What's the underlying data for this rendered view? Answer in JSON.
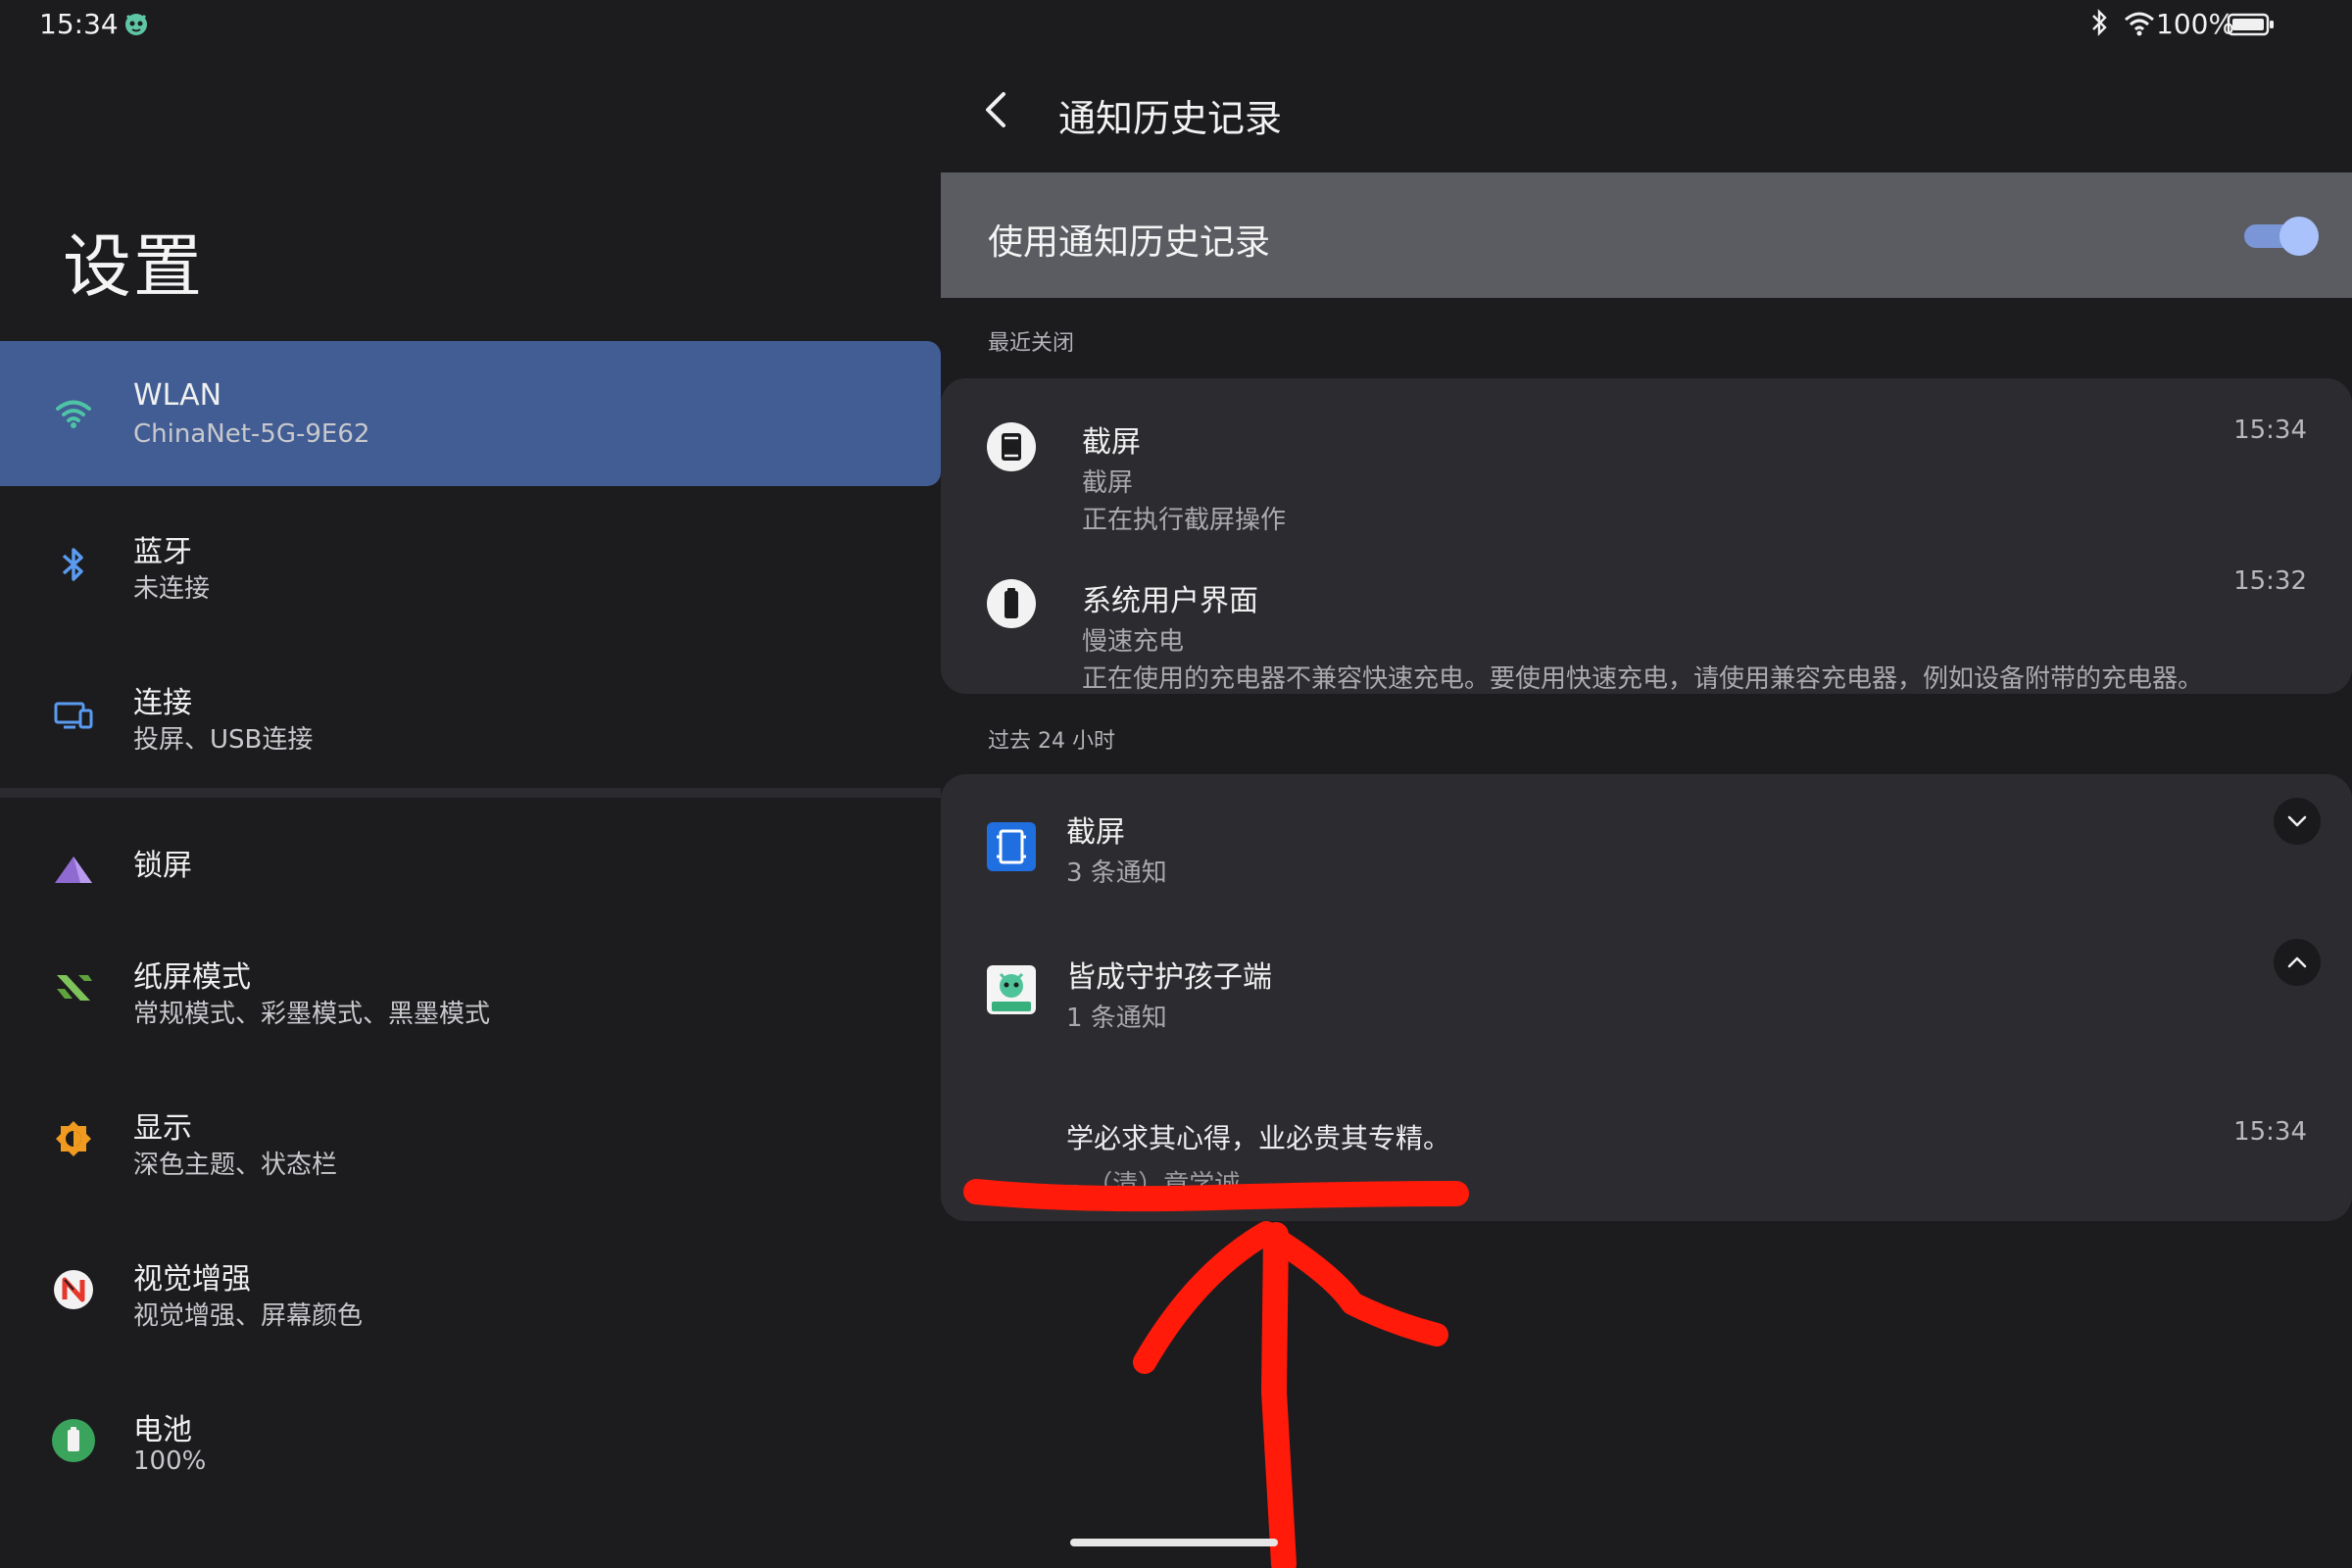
{
  "status": {
    "time": "15:34",
    "battery_text": "100%"
  },
  "settings": {
    "title": "设置",
    "items": [
      {
        "title": "WLAN",
        "subtitle": "ChinaNet-5G-9E62",
        "icon": "wifi-icon"
      },
      {
        "title": "蓝牙",
        "subtitle": "未连接",
        "icon": "bluetooth-icon"
      },
      {
        "title": "连接",
        "subtitle": "投屏、USB连接",
        "icon": "connection-icon"
      },
      {
        "title": "锁屏",
        "subtitle": "",
        "icon": "lock-screen-icon"
      },
      {
        "title": "纸屏模式",
        "subtitle": "常规模式、彩墨模式、黑墨模式",
        "icon": "paper-mode-icon"
      },
      {
        "title": "显示",
        "subtitle": "深色主题、状态栏",
        "icon": "display-icon"
      },
      {
        "title": "视觉增强",
        "subtitle": "视觉增强、屏幕颜色",
        "icon": "visual-enhance-icon"
      },
      {
        "title": "电池",
        "subtitle": "100%",
        "icon": "battery-icon"
      }
    ]
  },
  "page": {
    "title": "通知历史记录",
    "toggle_label": "使用通知历史记录",
    "toggle_on": true
  },
  "recent": {
    "label": "最近关闭",
    "items": [
      {
        "title": "截屏",
        "sub1": "截屏",
        "sub2": "正在执行截屏操作",
        "time": "15:34",
        "icon": "screenshot-icon"
      },
      {
        "title": "系统用户界面",
        "sub1": "慢速充电",
        "sub2": "正在使用的充电器不兼容快速充电。要使用快速充电，请使用兼容充电器，例如设备附带的充电器。",
        "time": "15:32",
        "icon": "battery-icon"
      }
    ]
  },
  "past": {
    "label": "过去 24 小时",
    "groups": [
      {
        "title": "截屏",
        "count": "3 条通知",
        "icon": "screenshot-app-icon",
        "chevron": "chevron-down-icon"
      },
      {
        "title": "皆成守护孩子端",
        "count": "1 条通知",
        "icon": "guardian-app-icon",
        "chevron": "chevron-up-icon"
      }
    ],
    "expanded_item": {
      "text": "学必求其心得，业必贵其专精。",
      "source": "– （清）章学诚",
      "time": "15:34"
    }
  },
  "colors": {
    "background": "#1c1c1f",
    "selected_item": "#415d93",
    "toggle_bar": "#5a5c62",
    "card": "#2c2c30",
    "switch_on": "#a9c2fb",
    "annotation": "#ff1a0a"
  }
}
